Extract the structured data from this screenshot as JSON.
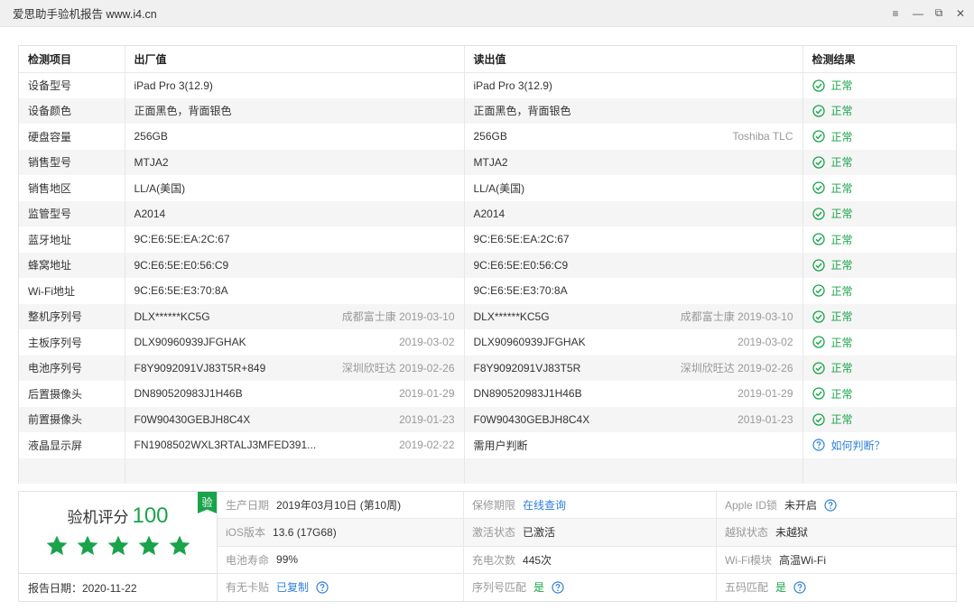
{
  "window": {
    "title": "爱思助手验机报告 www.i4.cn",
    "controls": [
      "≡",
      "—",
      "⧉",
      "✕"
    ]
  },
  "table": {
    "headers": [
      "检测项目",
      "出厂值",
      "读出值",
      "检测结果"
    ],
    "rows": [
      {
        "item": "设备型号",
        "factory": "iPad Pro 3(12.9)",
        "factory_note": "",
        "read": "iPad Pro 3(12.9)",
        "read_note": "",
        "result": "正常"
      },
      {
        "item": "设备颜色",
        "factory": "正面黑色，背面银色",
        "factory_note": "",
        "read": "正面黑色，背面银色",
        "read_note": "",
        "result": "正常"
      },
      {
        "item": "硬盘容量",
        "factory": "256GB",
        "factory_note": "",
        "read": "256GB",
        "read_note": "Toshiba TLC",
        "result": "正常"
      },
      {
        "item": "销售型号",
        "factory": "MTJA2",
        "factory_note": "",
        "read": "MTJA2",
        "read_note": "",
        "result": "正常"
      },
      {
        "item": "销售地区",
        "factory": "LL/A(美国)",
        "factory_note": "",
        "read": "LL/A(美国)",
        "read_note": "",
        "result": "正常"
      },
      {
        "item": "监管型号",
        "factory": "A2014",
        "factory_note": "",
        "read": "A2014",
        "read_note": "",
        "result": "正常"
      },
      {
        "item": "蓝牙地址",
        "factory": "9C:E6:5E:EA:2C:67",
        "factory_note": "",
        "read": "9C:E6:5E:EA:2C:67",
        "read_note": "",
        "result": "正常"
      },
      {
        "item": "蜂窝地址",
        "factory": "9C:E6:5E:E0:56:C9",
        "factory_note": "",
        "read": "9C:E6:5E:E0:56:C9",
        "read_note": "",
        "result": "正常"
      },
      {
        "item": "Wi-Fi地址",
        "factory": "9C:E6:5E:E3:70:8A",
        "factory_note": "",
        "read": "9C:E6:5E:E3:70:8A",
        "read_note": "",
        "result": "正常"
      },
      {
        "item": "整机序列号",
        "factory": "DLX******KC5G",
        "factory_note": "成都富士康 2019-03-10",
        "read": "DLX******KC5G",
        "read_note": "成都富士康 2019-03-10",
        "result": "正常"
      },
      {
        "item": "主板序列号",
        "factory": "DLX90960939JFGHAK",
        "factory_note": "2019-03-02",
        "read": "DLX90960939JFGHAK",
        "read_note": "2019-03-02",
        "result": "正常"
      },
      {
        "item": "电池序列号",
        "factory": "F8Y9092091VJ83T5R+849",
        "factory_note": "深圳欣旺达 2019-02-26",
        "read": "F8Y9092091VJ83T5R",
        "read_note": "深圳欣旺达 2019-02-26",
        "result": "正常"
      },
      {
        "item": "后置摄像头",
        "factory": "DN890520983J1H46B",
        "factory_note": "2019-01-29",
        "read": "DN890520983J1H46B",
        "read_note": "2019-01-29",
        "result": "正常"
      },
      {
        "item": "前置摄像头",
        "factory": "F0W90430GEBJH8C4X",
        "factory_note": "2019-01-23",
        "read": "F0W90430GEBJH8C4X",
        "read_note": "2019-01-23",
        "result": "正常"
      },
      {
        "item": "液晶显示屏",
        "factory": "FN1908502WXL3RTALJ3MFED391...",
        "factory_note": "2019-02-22",
        "read": "需用户判断",
        "read_note": "",
        "result": "如何判断？",
        "result_type": "link"
      }
    ]
  },
  "summary": {
    "score_label": "验机评分",
    "score": "100",
    "badge": "验",
    "stars": 5,
    "report_date": "报告日期：2020-11-22",
    "cells": [
      {
        "label": "生产日期",
        "value": "2019年03月10日 (第10周)",
        "style": "normal",
        "help": false
      },
      {
        "label": "保修期限",
        "value": "在线查询",
        "style": "blue",
        "help": false
      },
      {
        "label": "Apple ID锁",
        "value": "未开启",
        "style": "normal",
        "help": true
      },
      {
        "label": "iOS版本",
        "value": "13.6 (17G68)",
        "style": "normal",
        "help": false
      },
      {
        "label": "激活状态",
        "value": "已激活",
        "style": "normal",
        "help": false
      },
      {
        "label": "越狱状态",
        "value": "未越狱",
        "style": "normal",
        "help": false
      },
      {
        "label": "电池寿命",
        "value": "99%",
        "style": "normal",
        "help": false
      },
      {
        "label": "充电次数",
        "value": "445次",
        "style": "normal",
        "help": false
      },
      {
        "label": "Wi-Fi模块",
        "value": "高温Wi-Fi",
        "style": "normal",
        "help": false
      },
      {
        "label": "有无卡贴",
        "value": "已复制",
        "style": "blue",
        "help": true
      },
      {
        "label": "序列号匹配",
        "value": "是",
        "style": "green",
        "help": true
      },
      {
        "label": "五码匹配",
        "value": "是",
        "style": "green",
        "help": true
      }
    ]
  },
  "colors": {
    "ok_green": "#1aa34a",
    "link_blue": "#2f7fd8",
    "muted": "#999999"
  },
  "icons": {
    "ok": "check-circle-icon",
    "help": "question-circle-icon",
    "star": "star-icon"
  }
}
